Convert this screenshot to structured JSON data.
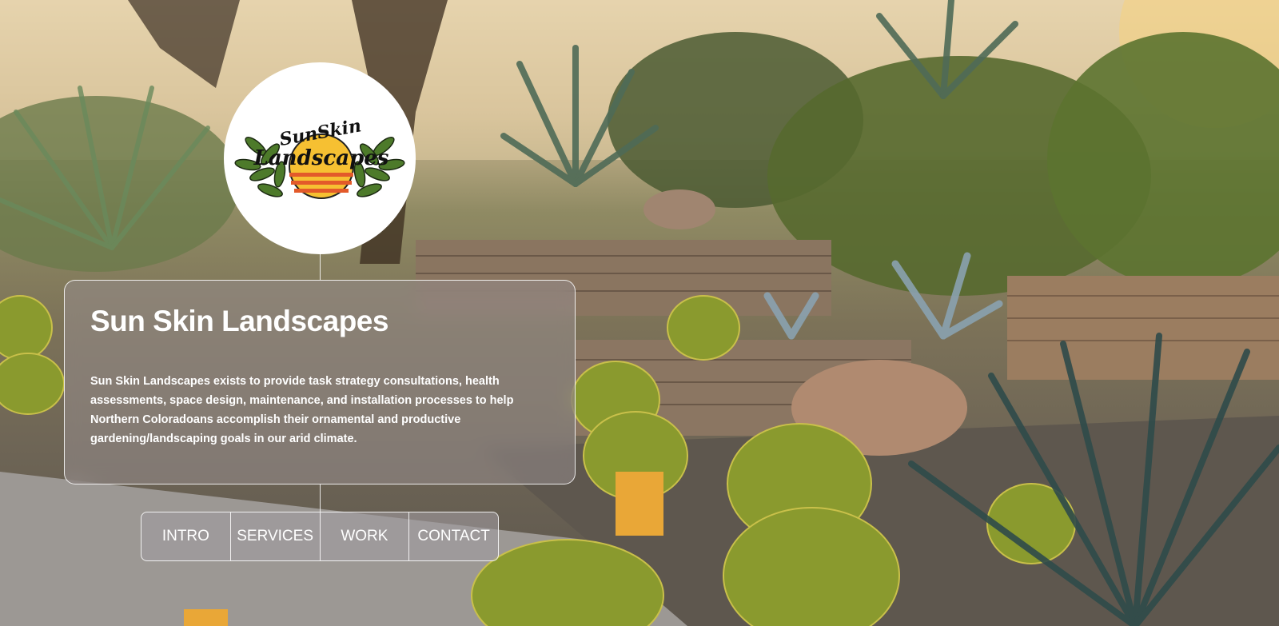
{
  "hero": {
    "title": "Sun Skin Landscapes",
    "description": "Sun Skin Landscapes exists to provide task strategy consultations, health assessments, space design, maintenance, and installation processes to help Northern Coloradoans accomplish their ornamental and productive gardening/landscaping goals in our arid climate."
  },
  "logo": {
    "line1": "SunSkin",
    "line2": "Landscapes"
  },
  "nav": {
    "items": [
      {
        "label": "INTRO"
      },
      {
        "label": "SERVICES"
      },
      {
        "label": "WORK"
      },
      {
        "label": "CONTACT"
      }
    ]
  },
  "colors": {
    "accent_sun": "#f6c032",
    "sun_stripe": "#e35a2a",
    "leaf": "#4d7a2a"
  }
}
